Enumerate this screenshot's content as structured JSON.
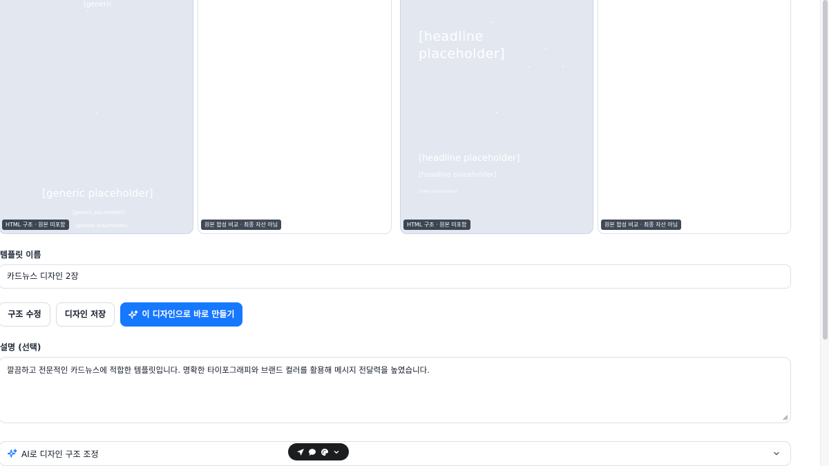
{
  "cards": [
    {
      "kind": "html",
      "badge": "HTML 구조 · 원본 미포함",
      "top_label": "[generic",
      "headline": "[generic placeholder]",
      "sub1": "[generic placeholder]",
      "sub2": "[generic placeholder]"
    },
    {
      "kind": "composite",
      "badge": "원본 합성 비교 · 최종 자산 아님"
    },
    {
      "kind": "html",
      "badge": "HTML 구조 · 원본 미포함",
      "big_headline_line1": "[headline",
      "big_headline_line2": "placeholder]",
      "headline": "[headline placeholder]",
      "sub1": "[headline placeholder]",
      "sub2": "[label placeholder]"
    },
    {
      "kind": "composite",
      "badge": "원본 합성 비교 · 최종 자산 아님"
    }
  ],
  "template_name": {
    "label": "템플릿 이름",
    "value": "카드뉴스 디자인 2장"
  },
  "actions": {
    "edit_structure": "구조 수정",
    "save_design": "디자인 저장",
    "create_now": "이 디자인으로 바로 만들기"
  },
  "description": {
    "label": "설명 (선택)",
    "value": "깔끔하고 전문적인 카드뉴스에 적합한 템플릿입니다. 명확한 타이포그래피와 브랜드 컬러를 활용해 메시지 전달력을 높였습니다."
  },
  "ai_adjust": {
    "label": "AI로 디자인 구조 조정",
    "icon": "sparkle-icon"
  },
  "floating_toolbar": {
    "icons": [
      "send-icon",
      "chat-icon",
      "palette-icon",
      "chevron-down-icon"
    ]
  },
  "colors": {
    "primary": "#1677ff",
    "html_card_bg": "#e3e7f0",
    "toolbar_bg": "#1c1d1f"
  }
}
